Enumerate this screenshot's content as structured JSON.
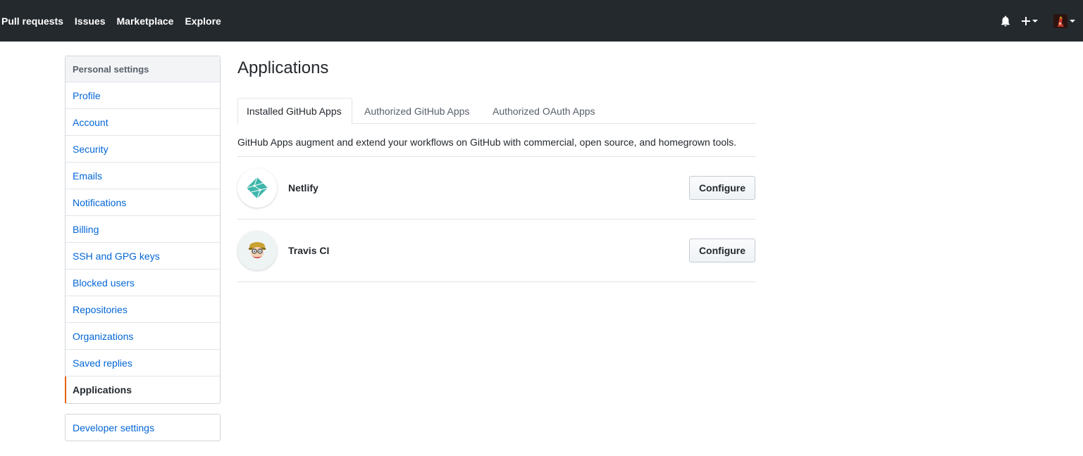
{
  "header": {
    "nav": [
      "Pull requests",
      "Issues",
      "Marketplace",
      "Explore"
    ],
    "icons": [
      "bell-icon",
      "plus-icon",
      "avatar"
    ],
    "background_color": "#24292e"
  },
  "sidebar": {
    "heading": "Personal settings",
    "items": [
      {
        "label": "Profile"
      },
      {
        "label": "Account"
      },
      {
        "label": "Security"
      },
      {
        "label": "Emails"
      },
      {
        "label": "Notifications"
      },
      {
        "label": "Billing"
      },
      {
        "label": "SSH and GPG keys"
      },
      {
        "label": "Blocked users"
      },
      {
        "label": "Repositories"
      },
      {
        "label": "Organizations"
      },
      {
        "label": "Saved replies"
      },
      {
        "label": "Applications",
        "selected": true
      }
    ],
    "developer_settings": "Developer settings",
    "selected_accent_color": "#e36209",
    "link_color": "#0366d6"
  },
  "main": {
    "title": "Applications",
    "tabs": [
      {
        "label": "Installed GitHub Apps",
        "selected": true
      },
      {
        "label": "Authorized GitHub Apps"
      },
      {
        "label": "Authorized OAuth Apps"
      }
    ],
    "description": "GitHub Apps augment and extend your workflows on GitHub with commercial, open source, and homegrown tools.",
    "apps": [
      {
        "name": "Netlify",
        "icon": "netlify-logo-icon",
        "button": "Configure"
      },
      {
        "name": "Travis CI",
        "icon": "travis-ci-logo-icon",
        "button": "Configure"
      }
    ]
  }
}
